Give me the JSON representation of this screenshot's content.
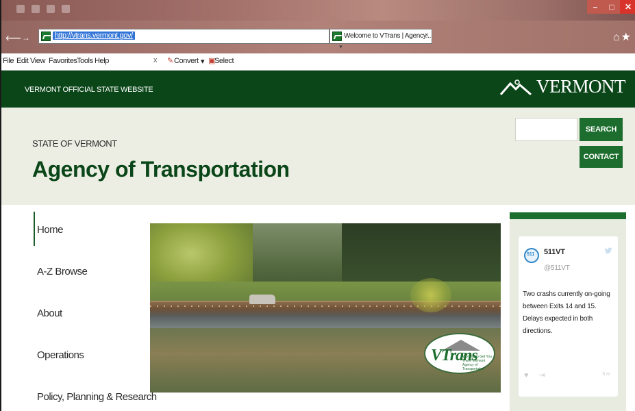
{
  "browser": {
    "url": "http://vtrans.vermont.gov/",
    "tab_title": "Welcome to VTrans | Agency...",
    "tab_close": "×",
    "address_tools": "⌕ ▾ ↻",
    "menu": [
      "File",
      "Edit",
      "View",
      "Favorites",
      "Tools",
      "Help"
    ],
    "addon_close": "x",
    "addon_convert": "Convert",
    "addon_dropdown": "▾",
    "addon_select": "Select",
    "window_buttons": {
      "minimize": "–",
      "maximize": "□",
      "close": "✕"
    },
    "icons": [
      "back-icon",
      "forward-icon",
      "search-icon",
      "refresh-icon",
      "home-icon",
      "favorites-star-icon"
    ]
  },
  "header": {
    "official_site": "VERMONT OFFICIAL STATE WEBSITE",
    "logo_word": "VERMONT",
    "state_label": "STATE OF VERMONT",
    "agency_title": "Agency of Transportation",
    "search_button": "SEARCH",
    "contact_button": "CONTACT",
    "search_placeholder": ""
  },
  "nav": {
    "items": [
      {
        "label": "Home",
        "active": true
      },
      {
        "label": "A-Z Browse",
        "active": false
      },
      {
        "label": "About",
        "active": false
      },
      {
        "label": "Operations",
        "active": false
      },
      {
        "label": "Policy, Planning & Research",
        "active": false
      }
    ]
  },
  "hero": {
    "badge_word": "VTrans",
    "badge_tagline": "Working to Get You There",
    "badge_subtitle": "Vermont Agency of Transportation"
  },
  "twitter": {
    "avatar_label": "511",
    "name": "511VT",
    "handle": "@511VT",
    "text": "Two crashs currently on-going between Exits 14 and 15. Delays expected in both directions.",
    "time": "5 m",
    "icons": [
      "twitter-bird-icon",
      "like-heart-icon",
      "share-icon"
    ]
  },
  "colors": {
    "state_green": "#0b4619",
    "button_green": "#1d6e2e",
    "agency_bg": "#eceee3",
    "browser_chrome": "#a3706a"
  }
}
